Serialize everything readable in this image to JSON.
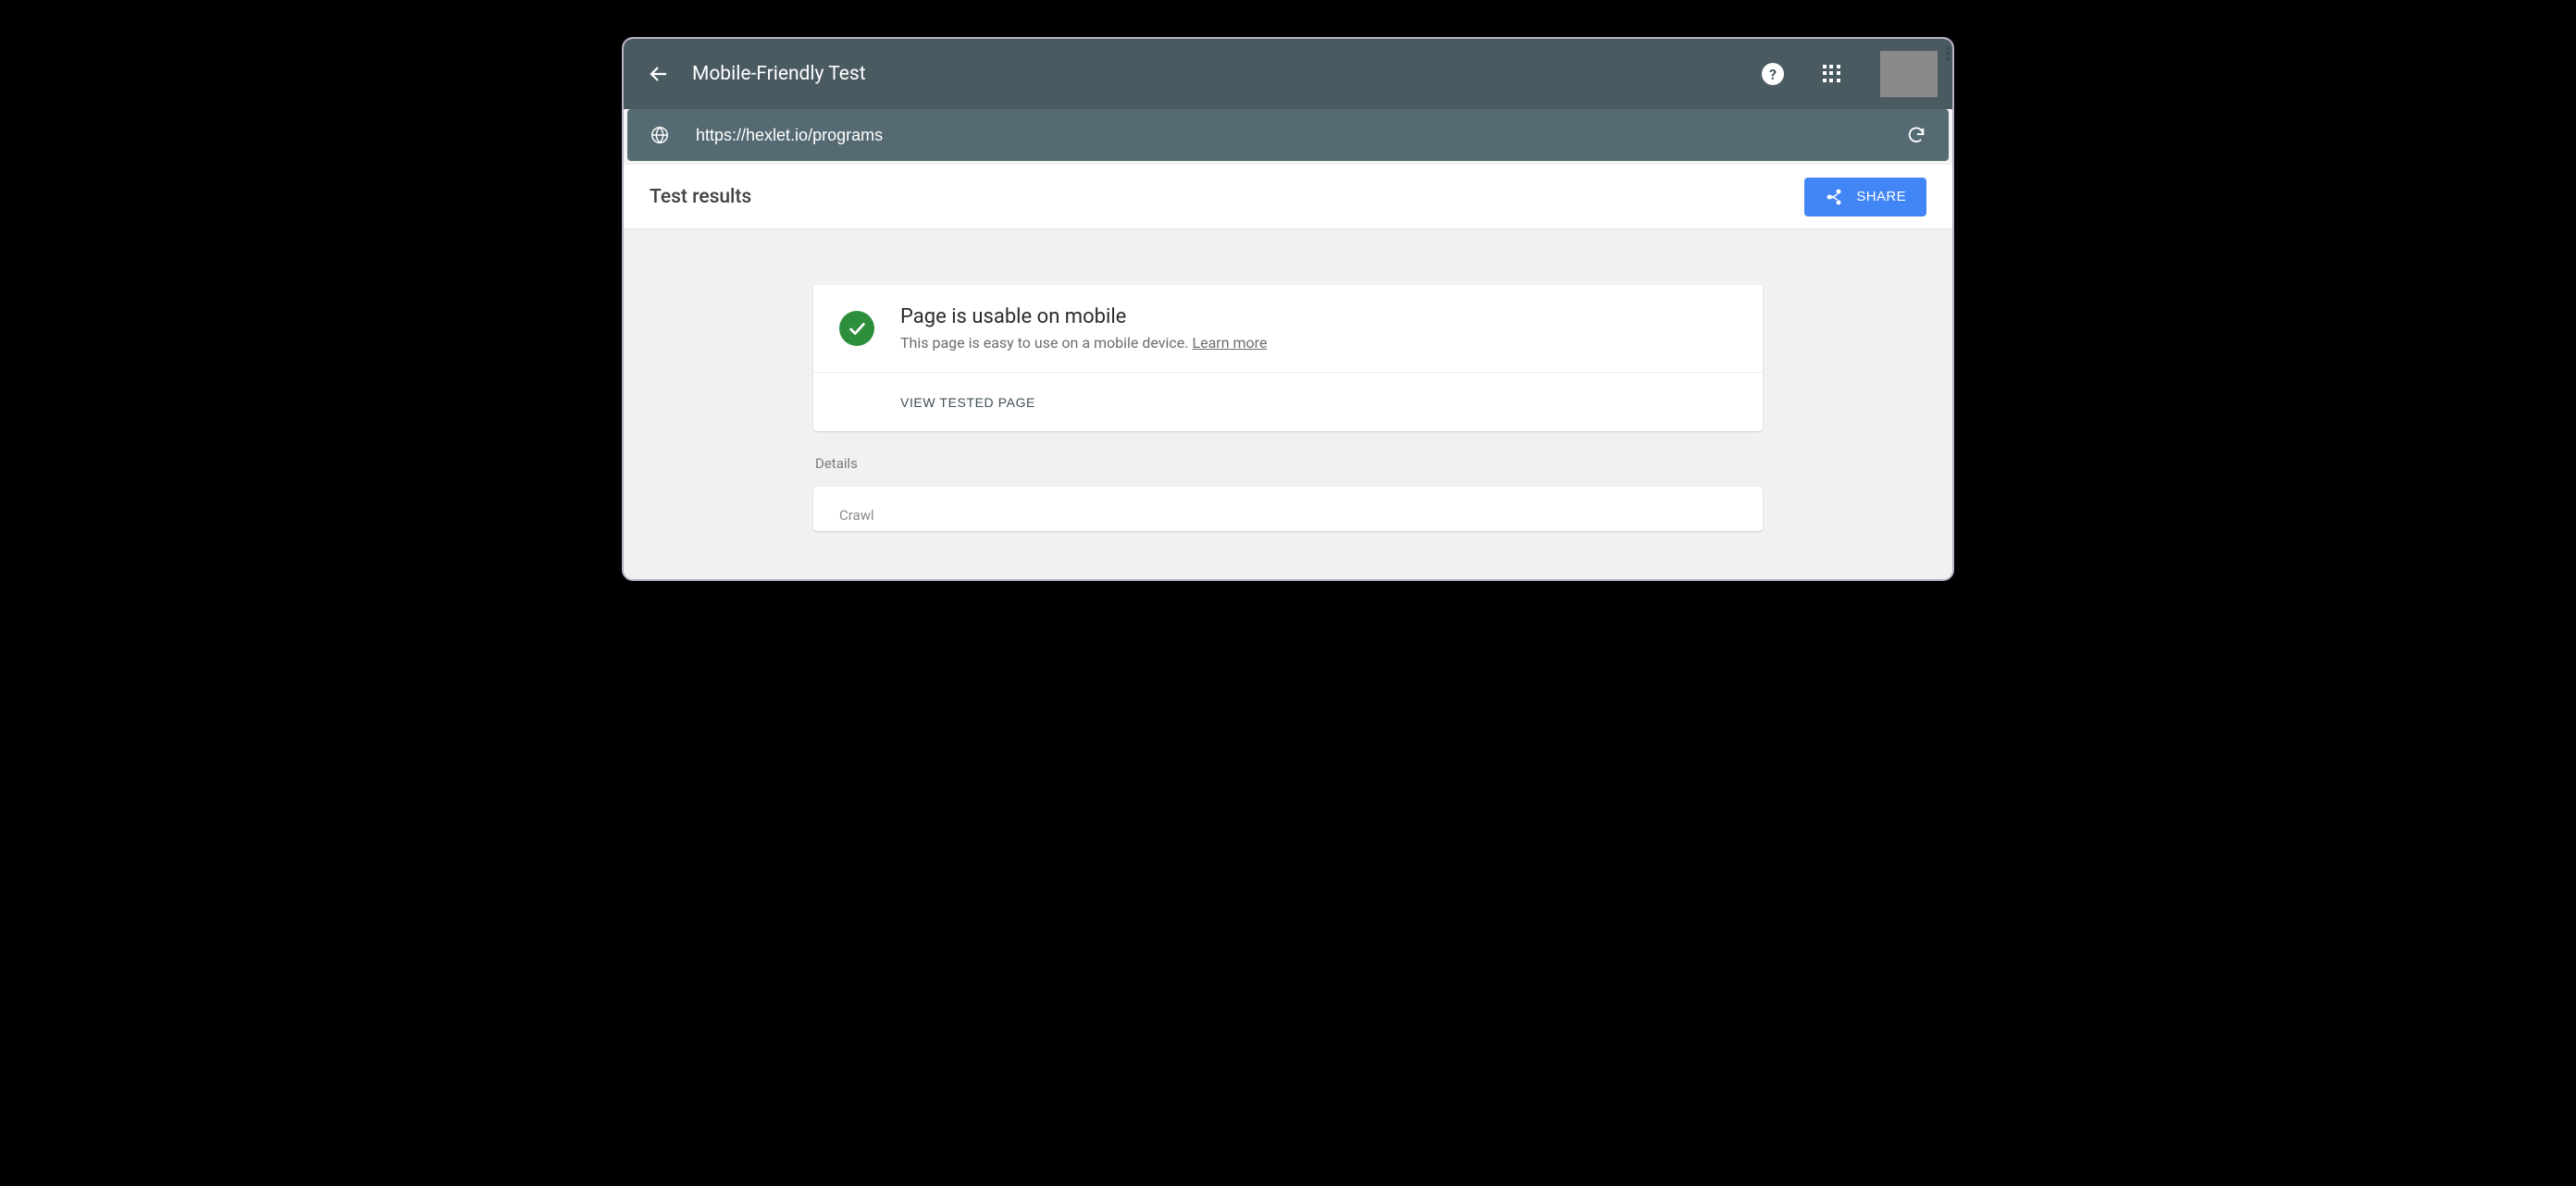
{
  "header": {
    "title": "Mobile-Friendly Test"
  },
  "urlbar": {
    "url_value": "https://hexlet.io/programs"
  },
  "results_header": {
    "title": "Test results",
    "share_label": "SHARE"
  },
  "status": {
    "heading": "Page is usable on mobile",
    "subtext": "This page is easy to use on a mobile device. ",
    "learn_more": "Learn more",
    "view_tested_label": "VIEW TESTED PAGE"
  },
  "details": {
    "section_label": "Details",
    "crawl_label": "Crawl"
  },
  "colors": {
    "header_bg": "#4a5a61",
    "urlbar_bg": "#556a72",
    "accent": "#4285f4",
    "success": "#2d8f3c"
  }
}
